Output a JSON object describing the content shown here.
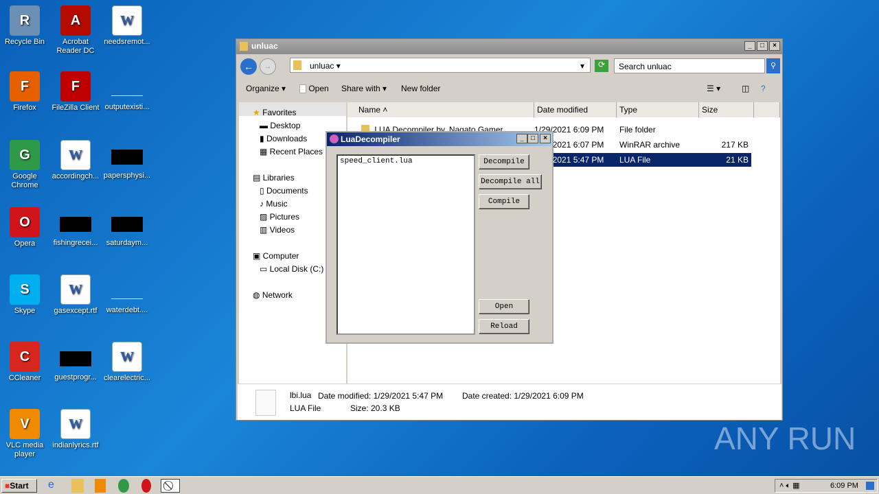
{
  "desktop_icons": [
    {
      "label": "Recycle Bin",
      "icon": "recycle-bin-icon",
      "color": "#6c8fb5"
    },
    {
      "label": "Acrobat Reader DC",
      "icon": "acrobat-icon",
      "color": "#b30b00"
    },
    {
      "label": "needsremot...",
      "icon": "word-doc-icon",
      "color": ""
    },
    {
      "label": "Firefox",
      "icon": "firefox-icon",
      "color": "#e66000"
    },
    {
      "label": "FileZilla Client",
      "icon": "filezilla-icon",
      "color": "#bf0000"
    },
    {
      "label": "outputexisti...",
      "icon": "file-icon",
      "color": ""
    },
    {
      "label": "Google Chrome",
      "icon": "chrome-icon",
      "color": "#2e9a47"
    },
    {
      "label": "accordingch...",
      "icon": "word-doc-icon",
      "color": ""
    },
    {
      "label": "papersphysi...",
      "icon": "file-icon",
      "color": ""
    },
    {
      "label": "Opera",
      "icon": "opera-icon",
      "color": "#d0141c"
    },
    {
      "label": "fishingrecei...",
      "icon": "file-icon",
      "color": ""
    },
    {
      "label": "saturdaym...",
      "icon": "file-icon",
      "color": ""
    },
    {
      "label": "Skype",
      "icon": "skype-icon",
      "color": "#00aff0"
    },
    {
      "label": "gasexcept.rtf",
      "icon": "word-doc-icon",
      "color": ""
    },
    {
      "label": "waterdebt....",
      "icon": "file-icon",
      "color": ""
    },
    {
      "label": "CCleaner",
      "icon": "ccleaner-icon",
      "color": "#d7261e"
    },
    {
      "label": "guestprogr...",
      "icon": "file-icon",
      "color": ""
    },
    {
      "label": "clearelectric...",
      "icon": "word-doc-icon",
      "color": ""
    },
    {
      "label": "VLC media player",
      "icon": "vlc-icon",
      "color": "#f08a00"
    },
    {
      "label": "indianlyrics.rtf",
      "icon": "word-doc-icon",
      "color": ""
    }
  ],
  "explorer": {
    "title": "unluac",
    "address": "unluac",
    "search_placeholder": "Search unluac",
    "toolbar": {
      "organize": "Organize",
      "open": "Open",
      "share_with": "Share with",
      "new_folder": "New folder"
    },
    "nav": {
      "favorites": "Favorites",
      "desktop": "Desktop",
      "downloads": "Downloads",
      "recent": "Recent Places",
      "libraries": "Libraries",
      "documents": "Documents",
      "music": "Music",
      "pictures": "Pictures",
      "videos": "Videos",
      "computer": "Computer",
      "local_disk": "Local Disk (C:)",
      "network": "Network"
    },
    "columns": {
      "name": "Name",
      "date": "Date modified",
      "type": "Type",
      "size": "Size"
    },
    "rows": [
      {
        "name": ".LUA Decompiler by. Nagato Gamer",
        "date": "1/29/2021 6:09 PM",
        "type": "File folder",
        "size": ""
      },
      {
        "name": "",
        "date": "1/29/2021 6:07 PM",
        "type": "WinRAR archive",
        "size": "217 KB"
      },
      {
        "name": "lbi.lua",
        "date": "1/29/2021 5:47 PM",
        "type": "LUA File",
        "size": "21 KB"
      }
    ],
    "status": {
      "name": "lbi.lua",
      "modified": "Date modified: 1/29/2021 5:47 PM",
      "created": "Date created: 1/29/2021 6:09 PM",
      "type": "LUA File",
      "size": "Size: 20.3 KB"
    }
  },
  "dialog": {
    "title": "LuaDecompiler",
    "file": "speed_client.lua",
    "decompile": "Decompile",
    "decompile_all": "Decompile all",
    "compile": "Compile",
    "open": "Open",
    "reload": "Reload"
  },
  "taskbar": {
    "start": "Start",
    "time": "6:09 PM"
  },
  "watermark": "ANY RUN"
}
